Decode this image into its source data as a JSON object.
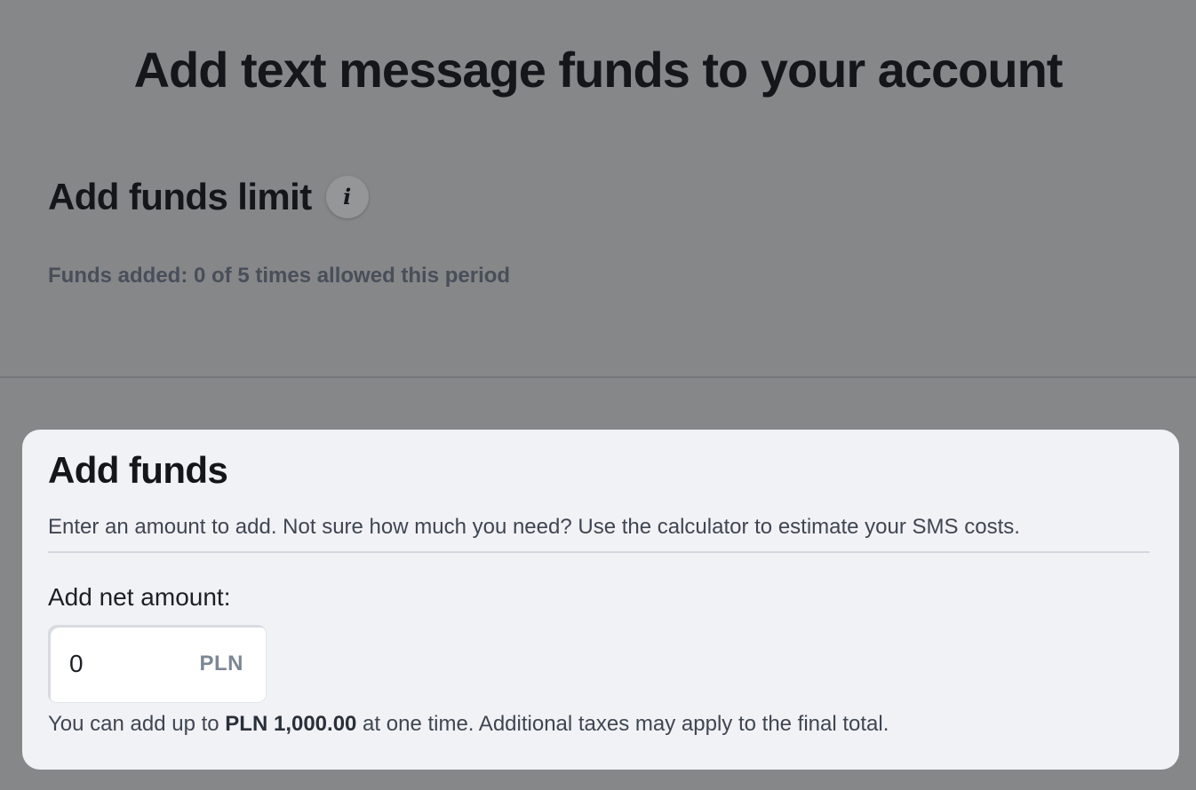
{
  "page": {
    "title": "Add text message funds to your account"
  },
  "limit": {
    "heading": "Add funds limit",
    "info_icon_glyph": "i",
    "status": "Funds added: 0 of 5 times allowed this period"
  },
  "add_funds": {
    "heading": "Add funds",
    "description": "Enter an amount to add. Not sure how much you need? Use the calculator to estimate your SMS costs.",
    "amount_label": "Add net amount:",
    "amount_value": "0",
    "currency": "PLN",
    "hint_prefix": "You can add up to ",
    "hint_limit": "PLN 1,000.00",
    "hint_suffix": " at one time. Additional taxes may apply to the final total."
  },
  "colors": {
    "overlay_background": "#868789",
    "card_background": "#f1f2f6",
    "heading_text": "#141619",
    "muted_text": "#484f59",
    "currency_text": "#7b8794"
  }
}
